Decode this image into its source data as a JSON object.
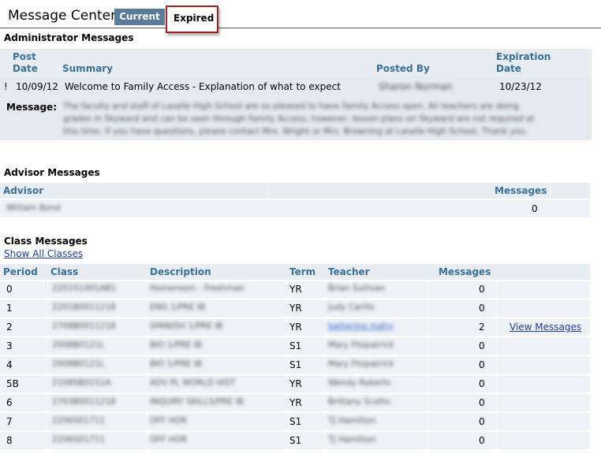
{
  "header": {
    "title": "Message Center",
    "tab_current": "Current",
    "tab_expired": "Expired"
  },
  "admin": {
    "section_title": "Administrator Messages",
    "col_post_date_1": "Post",
    "col_post_date_2": "Date",
    "col_summary": "Summary",
    "col_posted_by": "Posted By",
    "col_exp_1": "Expiration",
    "col_exp_2": "Date",
    "row": {
      "flag": "!",
      "post_date": "10/09/12",
      "summary": "Welcome to Family Access - Explanation of what to expect",
      "posted_by": "Sharon Norman",
      "exp_date": "10/23/12"
    },
    "message_label": "Message:",
    "message_lines": [
      "The faculty and staff of Lasalle High School are so pleased to have Family Access open. All teachers are doing",
      "grades in Skyward and can be seen through Family Access; however, lesson plans on Skyward are not required at",
      "this time. If you have questions, please contact Mrs. Wright or Mrs. Browning at Lasalle High School.  Thank you."
    ]
  },
  "advisor": {
    "section_title": "Advisor Messages",
    "col_advisor": "Advisor",
    "col_messages": "Messages",
    "row": {
      "advisor": "William Bond",
      "messages": "0"
    }
  },
  "classes": {
    "section_title": "Class Messages",
    "show_all": "Show All Classes",
    "columns": {
      "period": "Period",
      "class": "Class",
      "description": "Description",
      "term": "Term",
      "teacher": "Teacher",
      "messages": "Messages"
    },
    "rows": [
      {
        "period": "0",
        "class": "2201S1001AB1",
        "description": "Homeroom - Freshman",
        "term": "YR",
        "teacher": "Brian Sullivan",
        "messages": "0",
        "action": ""
      },
      {
        "period": "1",
        "class": "2201B0011218",
        "description": "ENG 1/PRE IB",
        "term": "YR",
        "teacher": "Judy Carillo",
        "messages": "0",
        "action": ""
      },
      {
        "period": "2",
        "class": "2708B0011218",
        "description": "SPANISH 1/PRE IB",
        "term": "YR",
        "teacher": "katherine mahy",
        "messages": "2",
        "action": "View Messages"
      },
      {
        "period": "3",
        "class": "2008B0121L",
        "description": "BIO 1/PRE IB",
        "term": "S1",
        "teacher": "Mary Fitzpatrick",
        "messages": "0",
        "action": ""
      },
      {
        "period": "4",
        "class": "2008B0121L",
        "description": "BIO 1/PRE IB",
        "term": "S1",
        "teacher": "Mary Fitzpatrick",
        "messages": "0",
        "action": ""
      },
      {
        "period": "5B",
        "class": "2108SB01S1A",
        "description": "ADV PL WORLD HIST",
        "term": "YR",
        "teacher": "Wendy Roberts",
        "messages": "0",
        "action": ""
      },
      {
        "period": "6",
        "class": "2703B0011218",
        "description": "INQUIRY SKILLS/PRE IB",
        "term": "YR",
        "teacher": "Brittany Scotto",
        "messages": "0",
        "action": ""
      },
      {
        "period": "7",
        "class": "2206S01711",
        "description": "OFF HOR",
        "term": "S1",
        "teacher": "TJ Hamilton",
        "messages": "0",
        "action": ""
      },
      {
        "period": "8",
        "class": "2206S01711",
        "description": "OFF HOR",
        "term": "S1",
        "teacher": "TJ Hamilton",
        "messages": "0",
        "action": ""
      }
    ]
  }
}
